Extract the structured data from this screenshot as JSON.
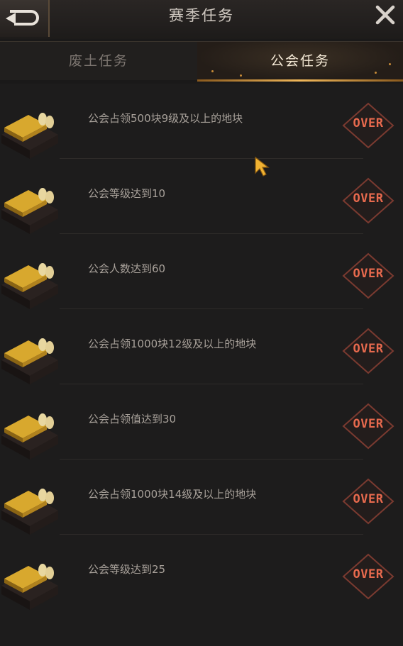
{
  "header": {
    "title": "赛季任务"
  },
  "tabs": [
    {
      "label": "废土任务",
      "active": false
    },
    {
      "label": "公会任务",
      "active": true
    }
  ],
  "tasks": [
    {
      "text": "公会占领500块9级及以上的地块",
      "status": "OVER"
    },
    {
      "text": "公会等级达到10",
      "status": "OVER"
    },
    {
      "text": "公会人数达到60",
      "status": "OVER"
    },
    {
      "text": "公会占领1000块12级及以上的地块",
      "status": "OVER"
    },
    {
      "text": "公会占领值达到30",
      "status": "OVER"
    },
    {
      "text": "公会占领1000块14级及以上的地块",
      "status": "OVER"
    },
    {
      "text": "公会等级达到25",
      "status": "OVER"
    }
  ],
  "colors": {
    "accent_gold": "#f0b75a",
    "over_red": "#e86a4e",
    "background": "#1d1c1c"
  },
  "icons": [
    "back-arrow-icon",
    "close-icon",
    "territory-reward-icon",
    "cursor-icon"
  ]
}
